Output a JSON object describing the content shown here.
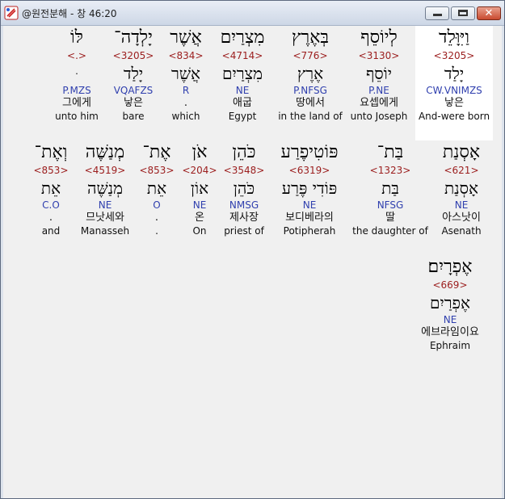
{
  "window": {
    "title": "@원전분해 - 창 46:20",
    "close_label": "✕"
  },
  "rows": [
    {
      "words": [
        {
          "heb": "וַיִּוָּלֵד",
          "strong": "<3205>",
          "heb2": "יָלַד",
          "code": "CW.VNIMZS",
          "kor": "낳은",
          "eng": "And-were born",
          "highlight": true
        },
        {
          "heb": "לְיוֹסֵף",
          "strong": "<3130>",
          "heb2": "יוֹסֵף",
          "code": "P.NE",
          "kor": "요셉에게",
          "eng": "unto Joseph"
        },
        {
          "heb": "בְּאֶרֶץ",
          "strong": "<776>",
          "heb2": "אֶרֶץ",
          "code": "P.NFSG",
          "kor": "땅에서",
          "eng": "in the land of"
        },
        {
          "heb": "מִצְרַיִם",
          "strong": "<4714>",
          "heb2": "מִצְרַיִם",
          "code": "NE",
          "kor": "애굽",
          "eng": "Egypt"
        },
        {
          "heb": "אֲשֶׁר",
          "strong": "<834>",
          "heb2": "אֲשֶׁר",
          "code": "R",
          "kor": ".",
          "eng": "which"
        },
        {
          "heb": "יָלְדָה־",
          "strong": "<3205>",
          "heb2": "יָלַד",
          "code": "VQAFZS",
          "kor": "낳은",
          "eng": "bare"
        },
        {
          "heb": "לּוֹ",
          "strong": "<.>",
          "heb2": "ּ",
          "code": "P.MZS",
          "kor": "그에게",
          "eng": "unto him"
        }
      ]
    },
    {
      "words": [
        {
          "heb": "אָסְנַת",
          "strong": "<621>",
          "heb2": "אָסְנַת",
          "code": "NE",
          "kor": "아스낫이",
          "eng": "Asenath"
        },
        {
          "heb": "בַּת־",
          "strong": "<1323>",
          "heb2": "בַּת",
          "code": "NFSG",
          "kor": "딸",
          "eng": "the daughter of"
        },
        {
          "heb": "פּוֹטִיפֶרַע",
          "strong": "<6319>",
          "heb2": "פּוֹדִי פֶּרַע",
          "code": "NE",
          "kor": "보디베라의",
          "eng": "Potipherah"
        },
        {
          "heb": "כֹּהֵן",
          "strong": "<3548>",
          "heb2": "כֹּהֵן",
          "code": "NMSG",
          "kor": "제사장",
          "eng": "priest of"
        },
        {
          "heb": "אֹן",
          "strong": "<204>",
          "heb2": "אוֹן",
          "code": "NE",
          "kor": "온",
          "eng": "On"
        },
        {
          "heb": "אֶת־",
          "strong": "<853>",
          "heb2": "אֵת",
          "code": "O",
          "kor": ".",
          "eng": "."
        },
        {
          "heb": "מְנַשֶּׁה",
          "strong": "<4519>",
          "heb2": "מְנַשֶּׁה",
          "code": "NE",
          "kor": "므낫세와",
          "eng": "Manasseh"
        },
        {
          "heb": "וְאֶת־",
          "strong": "<853>",
          "heb2": "אֵת",
          "code": "C.O",
          "kor": ".",
          "eng": "and"
        }
      ]
    },
    {
      "words": [
        {
          "heb": "אֶפְרָיִם׃",
          "strong": "<669>",
          "heb2": "אֶפְרַיִם",
          "code": "NE",
          "kor": "에브라임이요",
          "eng": "Ephraim"
        }
      ]
    }
  ]
}
